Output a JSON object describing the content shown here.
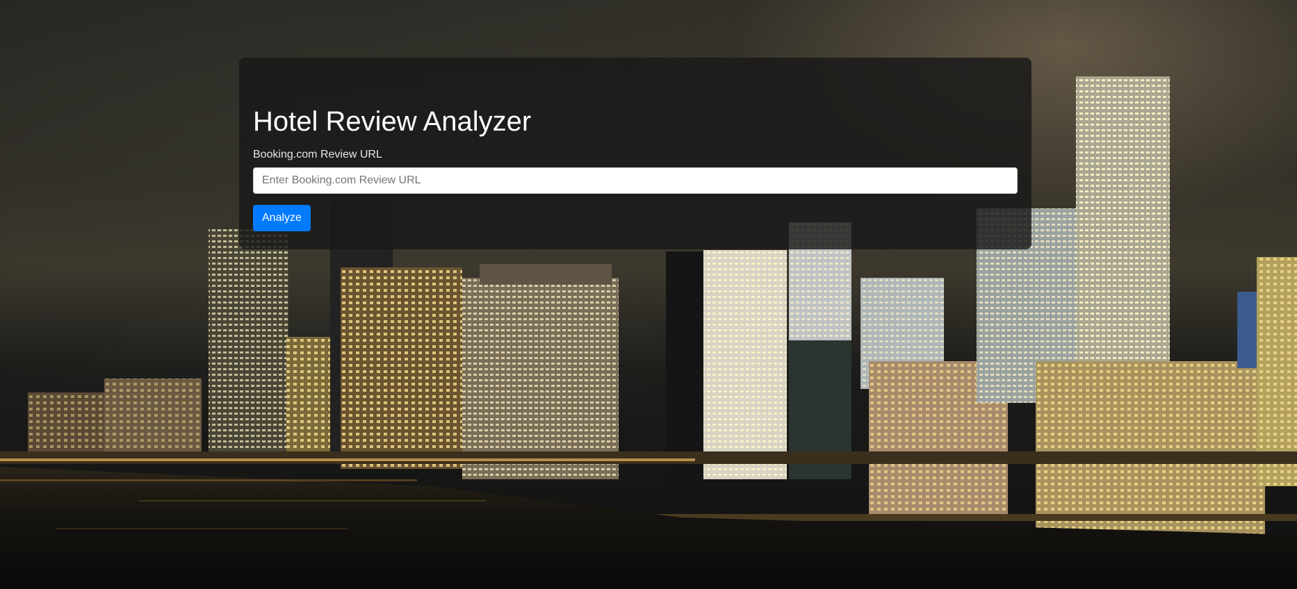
{
  "page": {
    "background_image": "night city skyline with waterfront"
  },
  "form": {
    "title": "Hotel Review Analyzer",
    "url_label": "Booking.com Review URL",
    "url_value": "",
    "url_placeholder": "Enter Booking.com Review URL",
    "submit_label": "Analyze"
  },
  "colors": {
    "accent": "#007bff",
    "panel_bg": "rgba(25,25,25,0.82)",
    "title_text": "#ffffff"
  }
}
